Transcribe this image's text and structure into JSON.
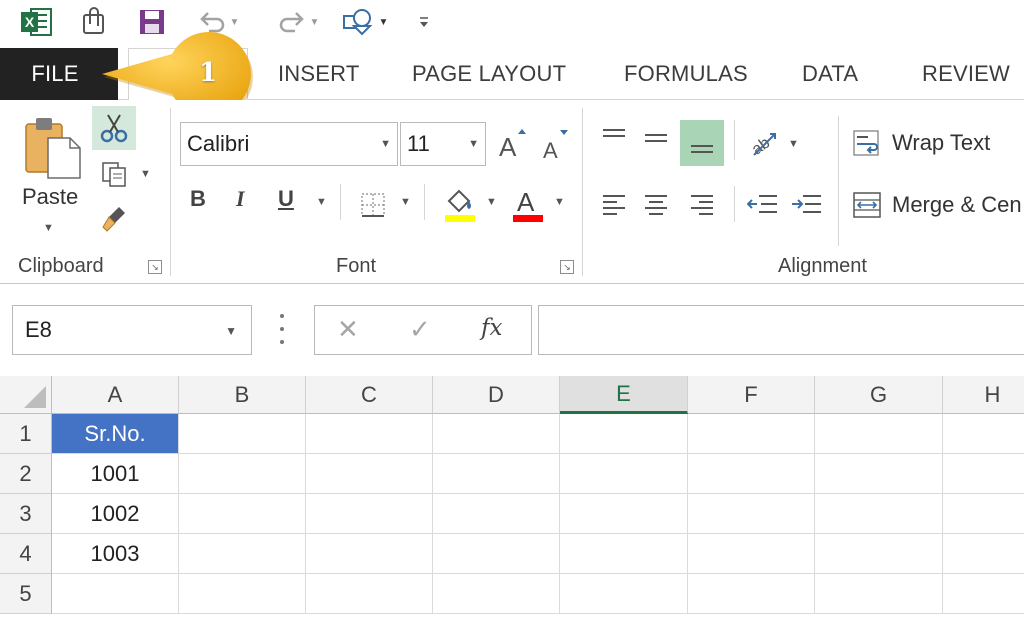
{
  "quick_access": {
    "app_icon": "excel-icon",
    "icons": [
      "attach-icon",
      "save-icon",
      "undo-icon",
      "redo-icon",
      "shapes-icon",
      "customize-toolbar-icon"
    ]
  },
  "tabs": [
    {
      "label": "FILE"
    },
    {
      "label": ""
    },
    {
      "label": "INSERT"
    },
    {
      "label": "PAGE LAYOUT"
    },
    {
      "label": "FORMULAS"
    },
    {
      "label": "DATA"
    },
    {
      "label": "REVIEW"
    }
  ],
  "callout": {
    "number": "1",
    "color": "#f2b318"
  },
  "ribbon": {
    "clipboard": {
      "paste_label": "Paste",
      "group_label": "Clipboard"
    },
    "font": {
      "font_name": "Calibri",
      "font_size": "11",
      "bold": "B",
      "italic": "I",
      "underline": "U",
      "group_label": "Font"
    },
    "alignment": {
      "wrap_text": "Wrap Text",
      "merge_center": "Merge & Cen",
      "group_label": "Alignment"
    }
  },
  "formula_bar": {
    "name_box": "E8",
    "cancel": "✕",
    "enter": "✓",
    "fx": "fx",
    "value": ""
  },
  "grid": {
    "columns": [
      "A",
      "B",
      "C",
      "D",
      "E",
      "F",
      "G",
      "H"
    ],
    "selected_column": "E",
    "rows": [
      "1",
      "2",
      "3",
      "4",
      "5"
    ],
    "cells": [
      [
        "Sr.No.",
        "",
        "",
        "",
        "",
        "",
        "",
        ""
      ],
      [
        "1001",
        "",
        "",
        "",
        "",
        "",
        "",
        ""
      ],
      [
        "1002",
        "",
        "",
        "",
        "",
        "",
        "",
        ""
      ],
      [
        "1003",
        "",
        "",
        "",
        "",
        "",
        "",
        ""
      ],
      [
        "",
        "",
        "",
        "",
        "",
        "",
        "",
        ""
      ]
    ]
  },
  "colors": {
    "excel_green": "#217346",
    "header_fill": "#4472c4",
    "highlight_yellow": "#ffff00",
    "font_red": "#ff0000"
  }
}
